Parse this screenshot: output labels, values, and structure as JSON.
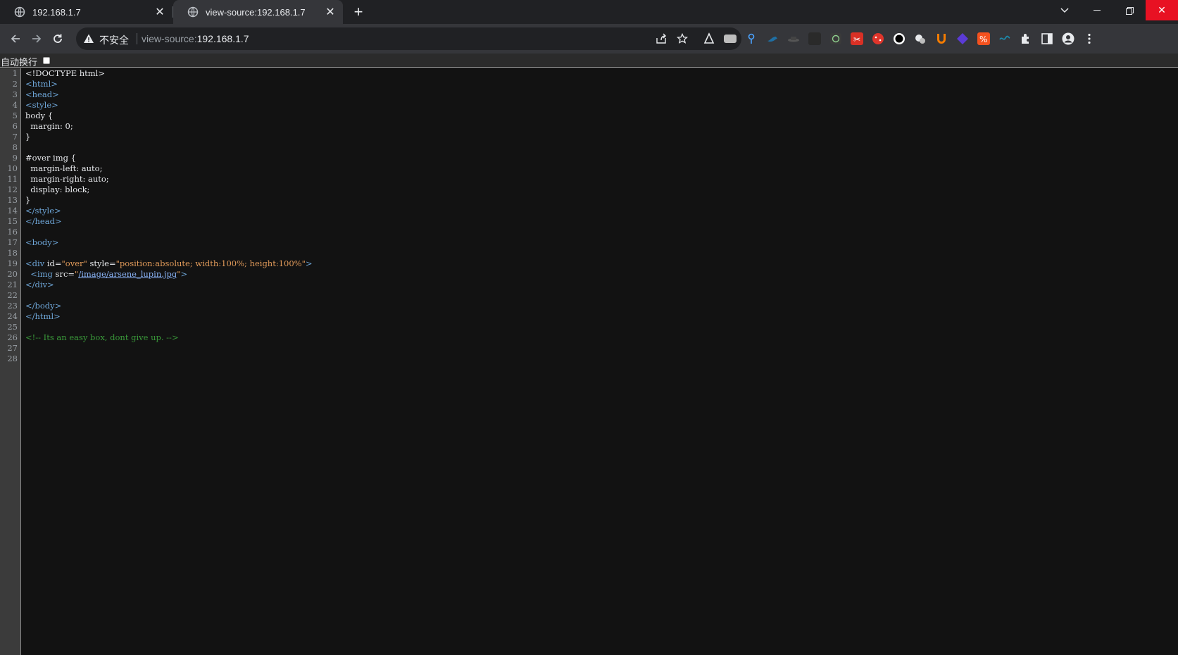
{
  "tabs": [
    {
      "title": "192.168.1.7",
      "active": false
    },
    {
      "title": "view-source:192.168.1.7",
      "active": true
    }
  ],
  "omnibox": {
    "security_label": "不安全",
    "url_prefix": "view-source:",
    "url_host": "192.168.1.7"
  },
  "wrap": {
    "label": "自动换行",
    "checked": false
  },
  "colors": {
    "tag": "#6ea6d8",
    "attr_value": "#e29b5a",
    "comment": "#3a9a3a",
    "link": "#8ab4f8",
    "close_hover": "#e81123"
  },
  "extensions": [
    "wappalyzer-icon",
    "extension-gray-icon",
    "pin-icon",
    "bird-icon",
    "hat-icon",
    "dark-square-icon",
    "circle-icon",
    "scissors-icon",
    "dice-icon",
    "black-circle-icon",
    "cookie-icon",
    "u-shield-icon",
    "gem-icon",
    "percent-icon",
    "wave-icon"
  ],
  "source": {
    "lines": [
      {
        "n": "1",
        "parts": [
          {
            "c": "attr",
            "t": "<!DOCTYPE html>"
          }
        ]
      },
      {
        "n": "2",
        "parts": [
          {
            "c": "tag",
            "t": "<html>"
          }
        ]
      },
      {
        "n": "3",
        "parts": [
          {
            "c": "tag",
            "t": "<head>"
          }
        ]
      },
      {
        "n": "4",
        "parts": [
          {
            "c": "tag",
            "t": "<style>"
          }
        ]
      },
      {
        "n": "5",
        "parts": [
          {
            "c": "attr",
            "t": "body {"
          }
        ]
      },
      {
        "n": "6",
        "parts": [
          {
            "c": "attr",
            "t": "  margin: 0;"
          }
        ]
      },
      {
        "n": "7",
        "parts": [
          {
            "c": "attr",
            "t": "}"
          }
        ]
      },
      {
        "n": "8",
        "parts": []
      },
      {
        "n": "9",
        "parts": [
          {
            "c": "attr",
            "t": "#over img {"
          }
        ]
      },
      {
        "n": "10",
        "parts": [
          {
            "c": "attr",
            "t": "  margin-left: auto;"
          }
        ]
      },
      {
        "n": "11",
        "parts": [
          {
            "c": "attr",
            "t": "  margin-right: auto;"
          }
        ]
      },
      {
        "n": "12",
        "parts": [
          {
            "c": "attr",
            "t": "  display: block;"
          }
        ]
      },
      {
        "n": "13",
        "parts": [
          {
            "c": "attr",
            "t": "}"
          }
        ]
      },
      {
        "n": "14",
        "parts": [
          {
            "c": "tag",
            "t": "</style>"
          }
        ]
      },
      {
        "n": "15",
        "parts": [
          {
            "c": "tag",
            "t": "</head>"
          }
        ]
      },
      {
        "n": "16",
        "parts": []
      },
      {
        "n": "17",
        "parts": [
          {
            "c": "tag",
            "t": "<body>"
          }
        ]
      },
      {
        "n": "18",
        "parts": []
      },
      {
        "n": "19",
        "parts": [
          {
            "c": "tag",
            "t": "<div "
          },
          {
            "c": "attr",
            "t": "id="
          },
          {
            "c": "val",
            "t": "\"over\""
          },
          {
            "c": "attr",
            "t": " style="
          },
          {
            "c": "val",
            "t": "\"position:absolute; width:100%; height:100%\""
          },
          {
            "c": "tag",
            "t": ">"
          }
        ]
      },
      {
        "n": "20",
        "parts": [
          {
            "c": "tag",
            "t": "  <img "
          },
          {
            "c": "attr",
            "t": "src="
          },
          {
            "c": "val",
            "t": "\""
          },
          {
            "c": "link",
            "t": "/image/arsene_lupin.jpg"
          },
          {
            "c": "val",
            "t": "\""
          },
          {
            "c": "tag",
            "t": ">"
          }
        ]
      },
      {
        "n": "21",
        "parts": [
          {
            "c": "tag",
            "t": "</div>"
          }
        ]
      },
      {
        "n": "22",
        "parts": []
      },
      {
        "n": "23",
        "parts": [
          {
            "c": "tag",
            "t": "</body>"
          }
        ]
      },
      {
        "n": "24",
        "parts": [
          {
            "c": "tag",
            "t": "</html>"
          }
        ]
      },
      {
        "n": "25",
        "parts": []
      },
      {
        "n": "26",
        "parts": [
          {
            "c": "cmt",
            "t": "<!-- Its an easy box, dont give up. -->"
          }
        ]
      },
      {
        "n": "27",
        "parts": []
      },
      {
        "n": "28",
        "parts": []
      }
    ]
  }
}
